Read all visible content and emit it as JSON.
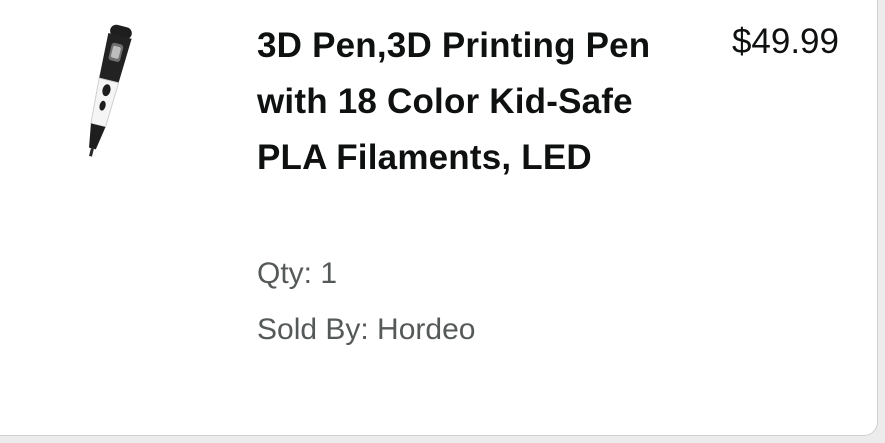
{
  "item": {
    "title": "3D Pen,3D Printing Pen with 18 Color Kid-Safe PLA Filaments, LED",
    "price": "$49.99",
    "quantity": "Qty: 1",
    "seller": "Sold By: Hordeo",
    "image_icon": "3d-pen-product-image"
  }
}
